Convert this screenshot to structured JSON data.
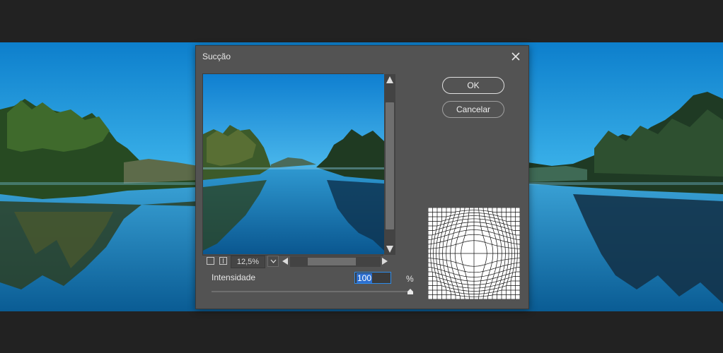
{
  "dialog": {
    "title": "Sucção",
    "ok_label": "OK",
    "cancel_label": "Cancelar",
    "close_icon": "close-icon"
  },
  "preview": {
    "zoom": "12,5%"
  },
  "intensity": {
    "label": "Intensidade",
    "value": "100",
    "unit": "%",
    "slider_fraction": 1.0
  },
  "colors": {
    "sky": "#1c8fd6",
    "water": "#1679b8",
    "dialog_bg": "#535353",
    "focus": "#2d8ceb"
  }
}
